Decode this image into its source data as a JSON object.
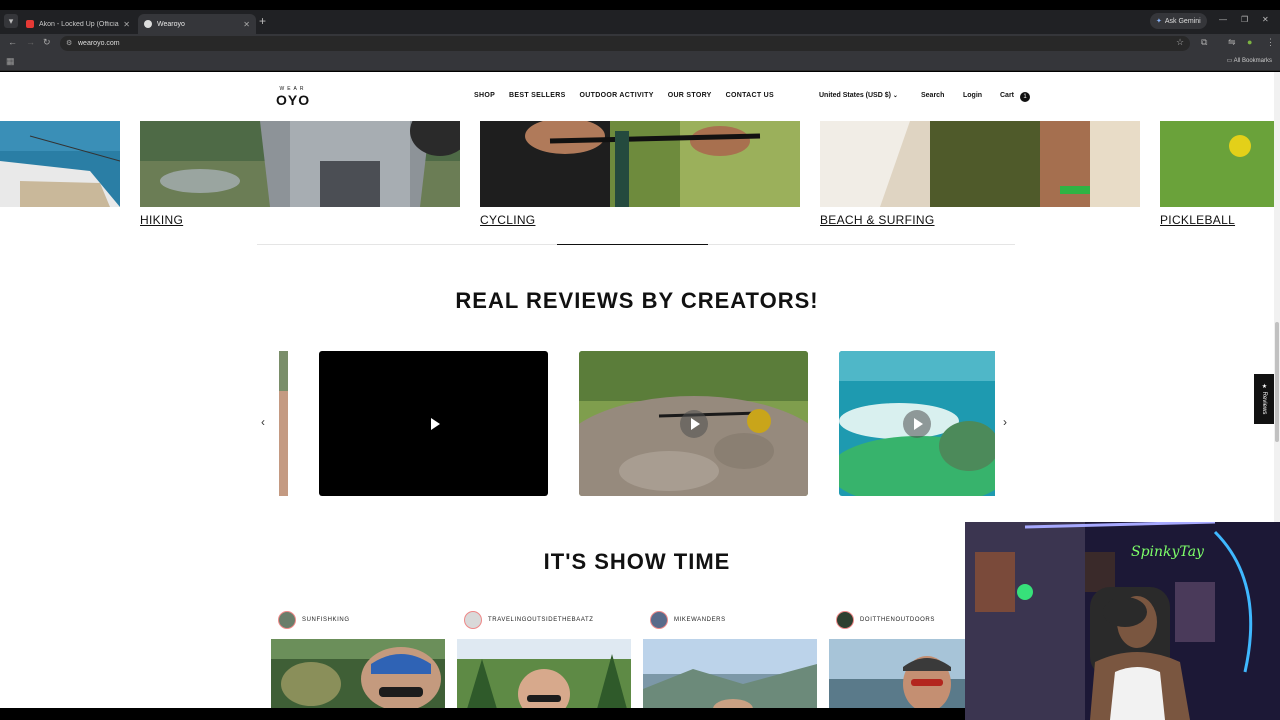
{
  "browser": {
    "tabs": [
      {
        "title": "Akon - Locked Up (Official Mu",
        "close": "✕"
      },
      {
        "title": "Wearoyo",
        "close": "✕"
      }
    ],
    "new_tab": "+",
    "ask_gemini": "Ask Gemini",
    "url": "wearoyo.com",
    "all_bookmarks": "All Bookmarks"
  },
  "header": {
    "logo_tag": "WEAR",
    "logo_mark": "OYO",
    "menu": [
      "SHOP",
      "BEST SELLERS",
      "OUTDOOR ACTIVITY",
      "OUR STORY",
      "CONTACT US"
    ],
    "currency": "United States (USD $)",
    "search": "Search",
    "login": "Login",
    "cart": "Cart",
    "cart_count": "1"
  },
  "activities": [
    "HIKING",
    "CYCLING",
    "BEACH & SURFING",
    "PICKLEBALL"
  ],
  "reviews": {
    "title": "REAL REVIEWS BY CREATORS!",
    "prev": "‹",
    "next": "›",
    "side_tab": "★ Reviews"
  },
  "showtime": {
    "title": "IT'S SHOW TIME",
    "creators": [
      "SUNFISHKING",
      "TRAVELINGOUTSIDETHEBAATZ",
      "MIKEWANDERS",
      "DOITTHENOUTDOORS"
    ]
  },
  "webcam": {
    "neon_sign": "SpinkyTay"
  },
  "colors": {
    "page_bg": "#ffffff",
    "text": "#111111",
    "browser_dark": "#202124",
    "browser_toolbar": "#35363a"
  }
}
